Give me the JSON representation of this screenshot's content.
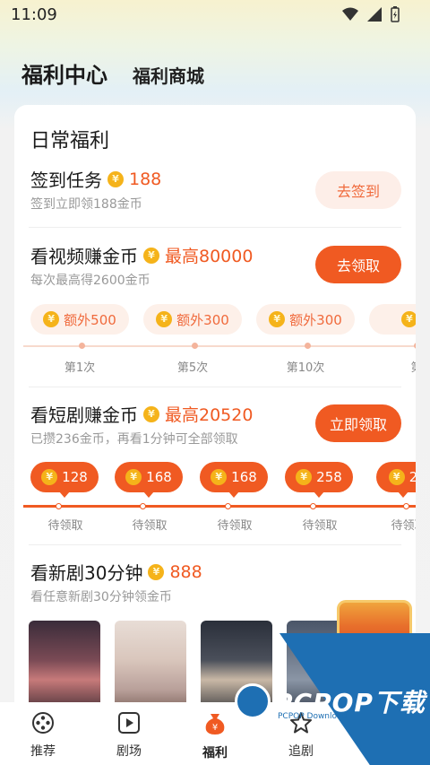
{
  "status": {
    "time": "11:09"
  },
  "header": {
    "tab_active": "福利中心",
    "tab_other": "福利商城"
  },
  "card": {
    "title": "日常福利",
    "checkin": {
      "title": "签到任务",
      "reward": "188",
      "sub": "签到立即领188金币",
      "button": "去签到"
    },
    "video": {
      "title": "看视频赚金币",
      "reward": "最高80000",
      "sub": "每次最高得2600金币",
      "button": "去领取",
      "chips": [
        "额外500",
        "额外300",
        "额外300",
        "额"
      ],
      "steps": [
        "第1次",
        "第5次",
        "第10次",
        "第"
      ]
    },
    "drama": {
      "title": "看短剧赚金币",
      "reward": "最高20520",
      "sub": "已攒236金币，再看1分钟可全部领取",
      "button": "立即领取",
      "bubbles": [
        "128",
        "168",
        "168",
        "258",
        "2"
      ],
      "steps": [
        "待领取",
        "待领取",
        "待领取",
        "待领取",
        "待领取"
      ]
    },
    "newdrama": {
      "title": "看新剧30分钟",
      "reward": "888",
      "sub": "看任意新剧30分钟领金币"
    },
    "coin_symbol": "¥"
  },
  "nav": {
    "items": [
      {
        "label": "推荐",
        "icon": "film-reel-icon"
      },
      {
        "label": "剧场",
        "icon": "play-box-icon"
      },
      {
        "label": "福利",
        "icon": "money-bag-icon"
      },
      {
        "label": "追剧",
        "icon": "star-icon"
      }
    ]
  },
  "watermark": {
    "main": "PCPOP下载",
    "sub": "PCPOP Download"
  },
  "colors": {
    "accent": "#f05a22",
    "accent_light": "#fdeee8",
    "coin": "#f5b31a"
  }
}
